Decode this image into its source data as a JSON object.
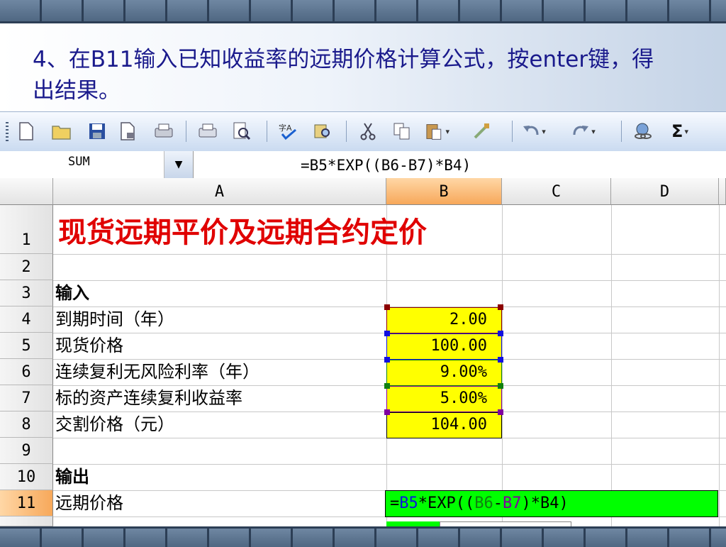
{
  "slide": {
    "instruction": "4、在B11输入已知收益率的远期价格计算公式，按enter键，得出结果。"
  },
  "toolbar": {
    "buttons": [
      "new-icon",
      "open-icon",
      "save-icon",
      "permission-icon",
      "print-area-icon",
      "print-icon",
      "print-preview-icon",
      "spelling-icon",
      "research-icon",
      "cut-icon",
      "copy-icon",
      "paste-icon",
      "format-painter-icon",
      "undo-icon",
      "redo-icon",
      "hyperlink-icon",
      "autosum-icon"
    ],
    "autosum_glyph": "Σ"
  },
  "formula_bar": {
    "name_box": "SUM",
    "formula": "=B5*EXP((B6-B7)*B4)"
  },
  "sheet": {
    "columns": [
      "A",
      "B",
      "C",
      "D"
    ],
    "rows": [
      "1",
      "2",
      "3",
      "4",
      "5",
      "6",
      "7",
      "8",
      "9",
      "10",
      "11"
    ],
    "selected_column": "B",
    "selected_row": "11",
    "title": "现货远期平价及远期合约定价",
    "section_input": "输入",
    "section_output": "输出",
    "labels": {
      "r4": "到期时间（年）",
      "r5": "现货价格",
      "r6": "连续复利无风险利率（年）",
      "r7": "标的资产连续复利收益率",
      "r8": "交割价格（元）",
      "r11": "远期价格"
    },
    "values": {
      "b4": "2.00",
      "b5": "100.00",
      "b6": "9.00%",
      "b7": "5.00%",
      "b8": "104.00"
    },
    "editing_cell": {
      "part1": "=",
      "ref_b5": "B5",
      "part2": "*EXP(",
      "ref_b6_open": "(",
      "ref_b6": "B6",
      "part3": "-",
      "ref_b7": "B7",
      "part4": ")*B4)"
    },
    "colors": {
      "input_fill": "#ffff00",
      "edit_fill": "#00ff00",
      "title_color": "#e00000",
      "selected_header": "#f7a85a"
    }
  }
}
